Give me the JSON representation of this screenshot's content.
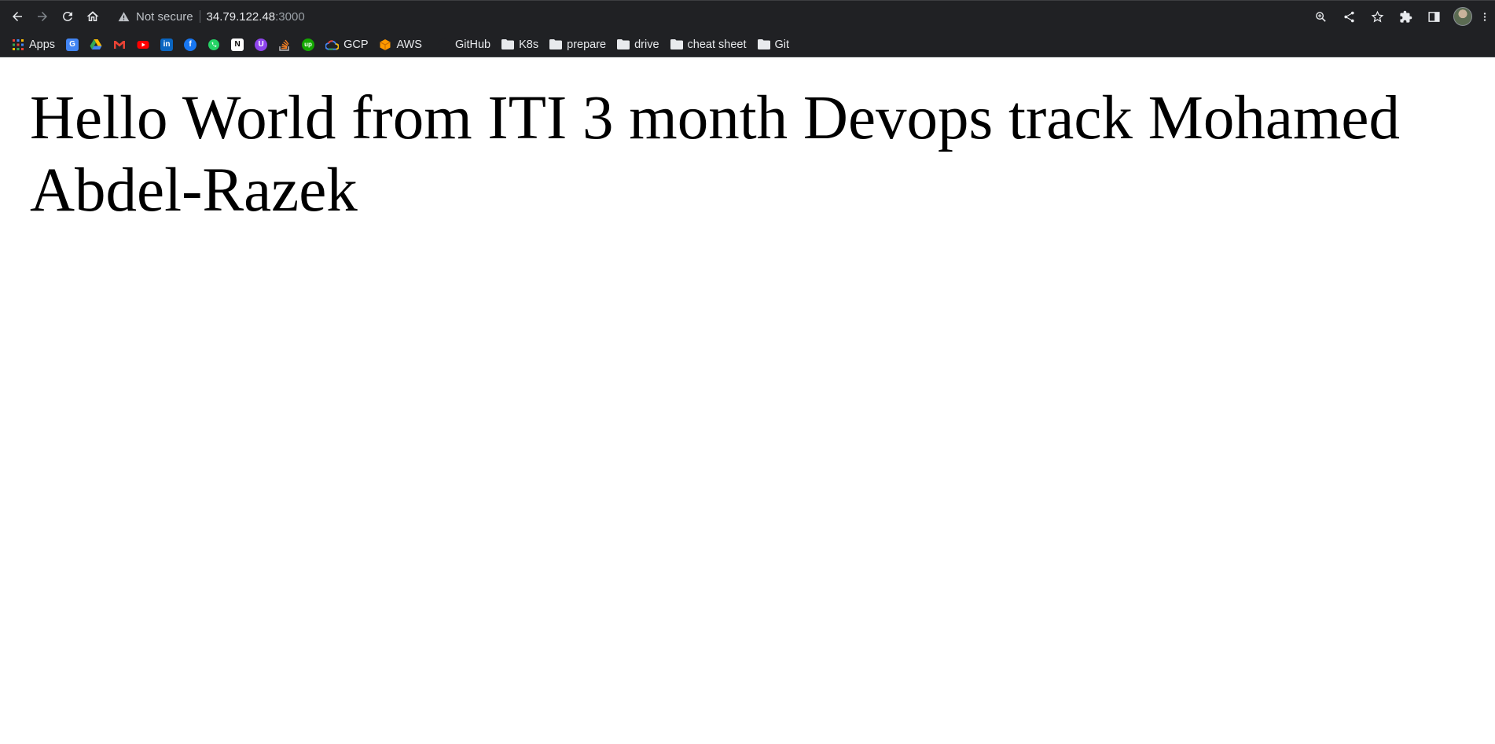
{
  "browser": {
    "security_label": "Not secure",
    "url_host": "34.79.122.48",
    "url_port": ":3000",
    "bookmarks": {
      "apps": "Apps",
      "gcp": "GCP",
      "aws": "AWS",
      "github": "GitHub",
      "k8s": "K8s",
      "prepare": "prepare",
      "drive": "drive",
      "cheat_sheet": "cheat sheet",
      "git": "Git"
    },
    "colors": {
      "toolbar_bg": "#202124",
      "text": "#e8eaed"
    }
  },
  "page": {
    "heading": "Hello World from ITI 3 month Devops track Mohamed Abdel-Razek"
  }
}
